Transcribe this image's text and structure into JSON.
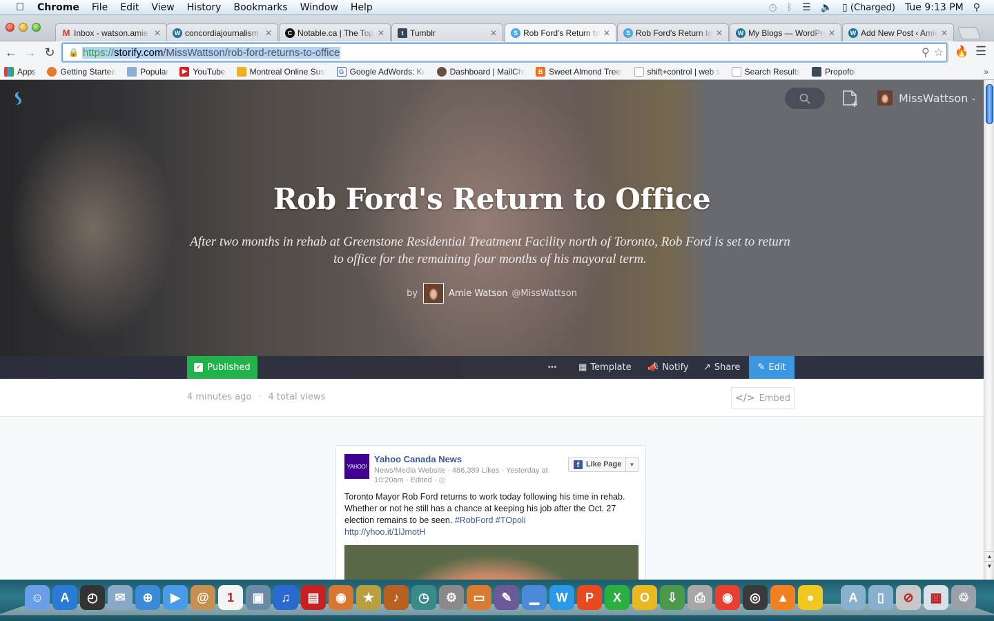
{
  "menubar": {
    "apple_icon": "apple-icon",
    "app_name": "Chrome",
    "items": [
      "File",
      "Edit",
      "View",
      "History",
      "Bookmarks",
      "Window",
      "Help"
    ],
    "status": {
      "battery": "(Charged)",
      "clock": "Tue 9:13 PM"
    }
  },
  "tabs": [
    {
      "title": "Inbox - watson.amie",
      "favicon": "gmail-icon",
      "active": false
    },
    {
      "title": "concordiajournalism",
      "favicon": "wordpress-icon",
      "active": false
    },
    {
      "title": "Notable.ca | The Top",
      "favicon": "notable-icon",
      "active": false
    },
    {
      "title": "Tumblr",
      "favicon": "tumblr-icon",
      "active": false
    },
    {
      "title": "Rob Ford's Return to",
      "favicon": "storify-icon",
      "active": true
    },
    {
      "title": "Rob Ford's Return to",
      "favicon": "storify-icon",
      "active": false
    },
    {
      "title": "My Blogs — WordPre",
      "favicon": "wordpress-icon",
      "active": false
    },
    {
      "title": "Add New Post ‹ Amie",
      "favicon": "wordpress-icon",
      "active": false
    }
  ],
  "omnibox": {
    "scheme": "https://",
    "host": "storify.com",
    "path": "/MissWattson/rob-ford-returns-to-office"
  },
  "bookmarks": [
    {
      "label": "Apps",
      "icon": "apps-grid-icon"
    },
    {
      "label": "Getting Started",
      "icon": "firefox-icon"
    },
    {
      "label": "Popular",
      "icon": "folder-icon"
    },
    {
      "label": "YouTube",
      "icon": "youtube-icon"
    },
    {
      "label": "Montreal Online Sust",
      "icon": "map-pin-icon"
    },
    {
      "label": "Google AdWords: Ke",
      "icon": "google-icon"
    },
    {
      "label": "Dashboard | MailChi",
      "icon": "mailchimp-icon"
    },
    {
      "label": "Sweet Almond Tree:",
      "icon": "blogger-icon"
    },
    {
      "label": "shift+control | web s",
      "icon": "page-icon"
    },
    {
      "label": "Search Results",
      "icon": "page-icon"
    },
    {
      "label": "Propofol",
      "icon": "image-icon"
    }
  ],
  "bookmarks_more": "»",
  "storify": {
    "user": "MissWattson",
    "story": {
      "title": "Rob Ford's Return to Office",
      "description": "After two months in rehab at Greenstone Residential Treatment Facility north of Toronto, Rob Ford is set to return to office for the remaining four months of his mayoral term.",
      "by_label": "by",
      "author_name": "Amie Watson",
      "author_handle": "@MissWattson"
    },
    "actions": {
      "published": "Published",
      "more": "•••",
      "template": "Template",
      "notify": "Notify",
      "share": "Share",
      "edit": "Edit"
    },
    "meta": {
      "updated": "4 minutes ago",
      "separator": "·",
      "views": "4 total views",
      "embed": "Embed"
    },
    "colors": {
      "published_green": "#22b24c",
      "edit_blue": "#3a97e0",
      "storify_blue": "#4aa8e8"
    }
  },
  "fb_post": {
    "page_name": "Yahoo Canada News",
    "logo_text": "YAHOO!",
    "meta": "News/Media Website · 486,389 Likes · Yesterday at 10:20am · Edited ·",
    "like_button": "Like Page",
    "body": "Toronto Mayor Rob Ford returns to work today following his time in rehab. Whether or not he still has a chance at keeping his job after the Oct. 27 election remains to be seen.",
    "hashtags": [
      "#RobFord",
      "#TOpoli"
    ],
    "link": "http://yhoo.it/1lJmotH"
  },
  "dock": [
    {
      "name": "finder-icon",
      "color": "#6a9ee8",
      "glyph": "☺"
    },
    {
      "name": "app-store-icon",
      "color": "#2a7ad8",
      "glyph": "A"
    },
    {
      "name": "dashboard-icon",
      "color": "#333",
      "glyph": "◴"
    },
    {
      "name": "mail-icon",
      "color": "#8aa8c8",
      "glyph": "✉"
    },
    {
      "name": "safari-icon",
      "color": "#3a8ad8",
      "glyph": "⊕"
    },
    {
      "name": "facetime-icon",
      "color": "#4a9ae8",
      "glyph": "▶"
    },
    {
      "name": "address-book-icon",
      "color": "#c89050",
      "glyph": "@"
    },
    {
      "name": "calendar-icon",
      "color": "#f4f4f4",
      "glyph": "1"
    },
    {
      "name": "iphoto-icon",
      "color": "#6a8aa8",
      "glyph": "▣"
    },
    {
      "name": "itunes-icon",
      "color": "#2a6ad0",
      "glyph": "♫"
    },
    {
      "name": "photo-booth-icon",
      "color": "#c82020",
      "glyph": "▤"
    },
    {
      "name": "image-capture-icon",
      "color": "#d87830",
      "glyph": "◉"
    },
    {
      "name": "imovie-icon",
      "color": "#b8a040",
      "glyph": "★"
    },
    {
      "name": "garageband-icon",
      "color": "#b86020",
      "glyph": "♪"
    },
    {
      "name": "time-machine-icon",
      "color": "#3a8a8a",
      "glyph": "◷"
    },
    {
      "name": "system-preferences-icon",
      "color": "#8a8a8a",
      "glyph": "⚙"
    },
    {
      "name": "keynote-icon",
      "color": "#d87a30",
      "glyph": "▭"
    },
    {
      "name": "script-editor-icon",
      "color": "#6a5a9a",
      "glyph": "✎"
    },
    {
      "name": "numbers-icon",
      "color": "#4a8ad8",
      "glyph": "▁"
    },
    {
      "name": "word-icon",
      "color": "#2a9ae8",
      "glyph": "W"
    },
    {
      "name": "powerpoint-icon",
      "color": "#e84a20",
      "glyph": "P"
    },
    {
      "name": "excel-icon",
      "color": "#2ab040",
      "glyph": "X"
    },
    {
      "name": "outlook-icon",
      "color": "#e8b820",
      "glyph": "O"
    },
    {
      "name": "downloader-icon",
      "color": "#4a9a4a",
      "glyph": "⇩"
    },
    {
      "name": "printer-icon",
      "color": "#a8a8a8",
      "glyph": "⎙"
    },
    {
      "name": "chrome-icon",
      "color": "#e84030",
      "glyph": "◉"
    },
    {
      "name": "logic-icon",
      "color": "#3a3a3a",
      "glyph": "◎"
    },
    {
      "name": "vlc-icon",
      "color": "#f08020",
      "glyph": "▲"
    },
    {
      "name": "cyberduck-icon",
      "color": "#f0c820",
      "glyph": "●"
    },
    {
      "name": "applications-folder-icon",
      "color": "#8ab0d0",
      "glyph": "A"
    },
    {
      "name": "documents-folder-icon",
      "color": "#8ab0d0",
      "glyph": "▯"
    },
    {
      "name": "disabled-app-icon",
      "color": "#c8c8c8",
      "glyph": "⊘"
    },
    {
      "name": "screenshot-icon",
      "color": "#d8e0e8",
      "glyph": "▦"
    },
    {
      "name": "trash-icon",
      "color": "#9aa0a8",
      "glyph": "♲"
    }
  ]
}
